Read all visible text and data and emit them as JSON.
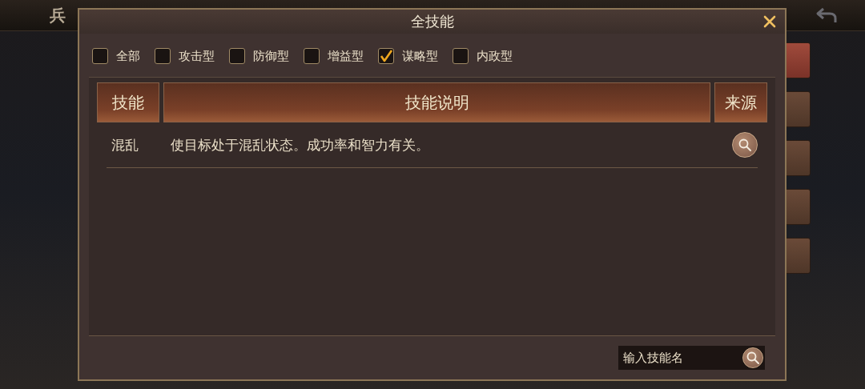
{
  "background": {
    "title": "兵",
    "side_tabs": [
      {
        "selected": true
      },
      {
        "selected": false
      },
      {
        "selected": false
      },
      {
        "selected": false
      },
      {
        "selected": false
      }
    ]
  },
  "dialog": {
    "title": "全技能",
    "filters": [
      {
        "label": "全部",
        "checked": false
      },
      {
        "label": "攻击型",
        "checked": false
      },
      {
        "label": "防御型",
        "checked": false
      },
      {
        "label": "增益型",
        "checked": false
      },
      {
        "label": "谋略型",
        "checked": true
      },
      {
        "label": "内政型",
        "checked": false
      }
    ],
    "table": {
      "columns": [
        "技能",
        "技能说明",
        "来源"
      ],
      "rows": [
        {
          "skill": "混乱",
          "description": "使目标处于混乱状态。成功率和智力有关。"
        }
      ]
    },
    "search": {
      "placeholder": "输入技能名"
    }
  }
}
